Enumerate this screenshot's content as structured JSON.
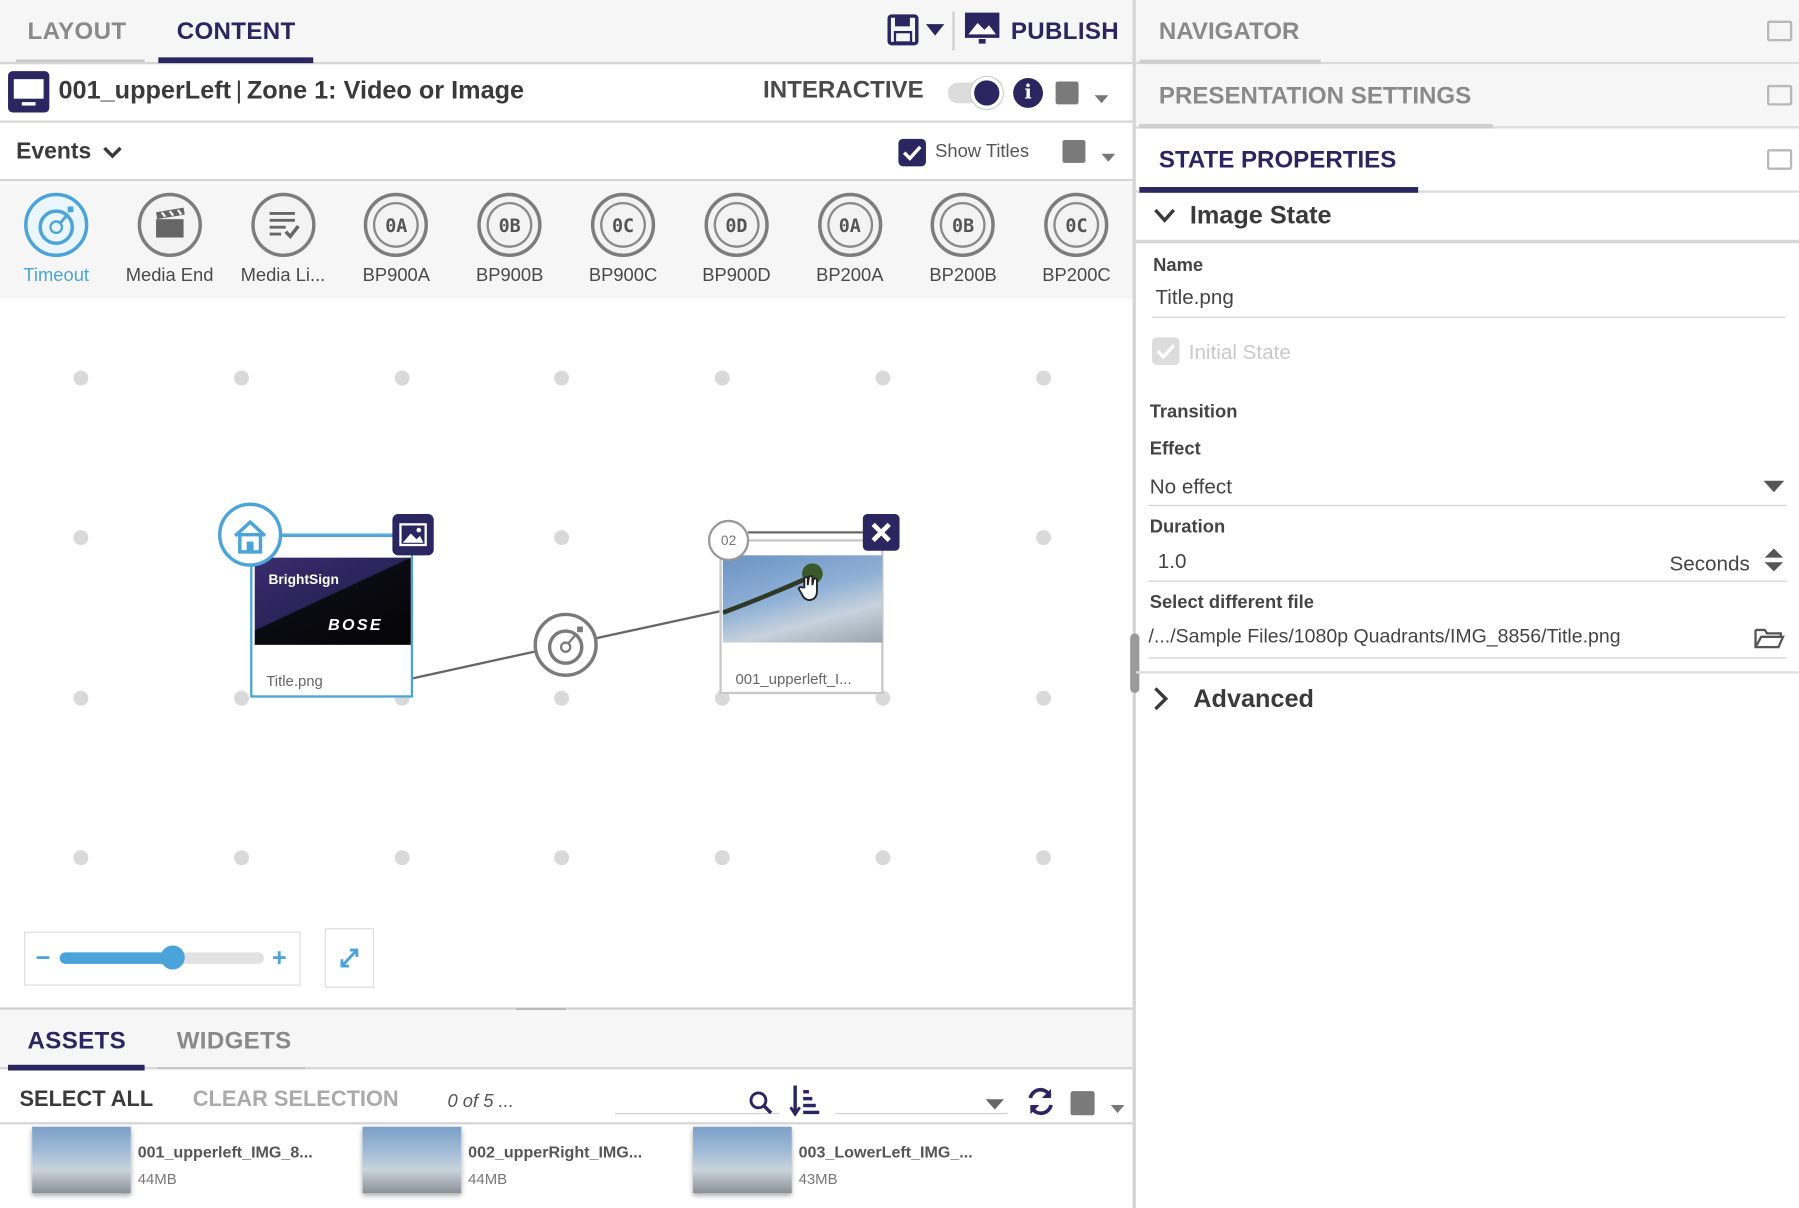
{
  "top_tabs": {
    "layout": "LAYOUT",
    "content": "CONTENT"
  },
  "toolbar": {
    "save_icon": "save-icon",
    "publish": "PUBLISH"
  },
  "zone": {
    "title": "001_upperLeft",
    "subtitle": "Zone 1: Video or Image",
    "mode": "INTERACTIVE"
  },
  "events_bar": {
    "label": "Events",
    "show_titles": "Show Titles",
    "show_titles_checked": true
  },
  "events": [
    {
      "label": "Timeout",
      "icon": "timeout-icon",
      "selected": true
    },
    {
      "label": "Media End",
      "icon": "clapperboard-icon"
    },
    {
      "label": "Media Li...",
      "icon": "media-list-icon"
    },
    {
      "label": "BP900A",
      "icon": "bp900a-icon"
    },
    {
      "label": "BP900B",
      "icon": "bp900b-icon"
    },
    {
      "label": "BP900C",
      "icon": "bp900c-icon"
    },
    {
      "label": "BP900D",
      "icon": "bp900d-icon"
    },
    {
      "label": "BP200A",
      "icon": "bp200a-icon"
    },
    {
      "label": "BP200B",
      "icon": "bp200b-icon"
    },
    {
      "label": "BP200C",
      "icon": "bp200c-icon"
    }
  ],
  "canvas": {
    "state1": {
      "brand": "BrightSign",
      "logo": "BOSE",
      "label": "Title.png"
    },
    "state2": {
      "badge": "02",
      "label": "001_upperleft_I..."
    },
    "zoom": {
      "value_fraction": 0.55
    }
  },
  "bottom_tabs": {
    "assets": "ASSETS",
    "widgets": "WIDGETS"
  },
  "assets_bar": {
    "select_all": "SELECT ALL",
    "clear_selection": "CLEAR SELECTION",
    "count": "0 of 5 ..."
  },
  "assets": [
    {
      "name": "001_upperleft_IMG_8...",
      "size": "44MB"
    },
    {
      "name": "002_upperRight_IMG...",
      "size": "44MB"
    },
    {
      "name": "003_LowerLeft_IMG_...",
      "size": "43MB"
    }
  ],
  "right_panel": {
    "navigator": "NAVIGATOR",
    "presentation_settings": "PRESENTATION SETTINGS",
    "state_properties": "STATE PROPERTIES",
    "section": "Image State",
    "name_label": "Name",
    "name_value": "Title.png",
    "initial_state": "Initial State",
    "transition": "Transition",
    "effect_label": "Effect",
    "effect_value": "No effect",
    "duration_label": "Duration",
    "duration_value": "1.0",
    "duration_unit": "Seconds",
    "file_label": "Select different file",
    "file_value": "/.../Sample Files/1080p Quadrants/IMG_8856/Title.png",
    "advanced": "Advanced"
  },
  "colors": {
    "accent": "#2b2560",
    "selected": "#4aa3d9",
    "publish": "#2b2560"
  }
}
